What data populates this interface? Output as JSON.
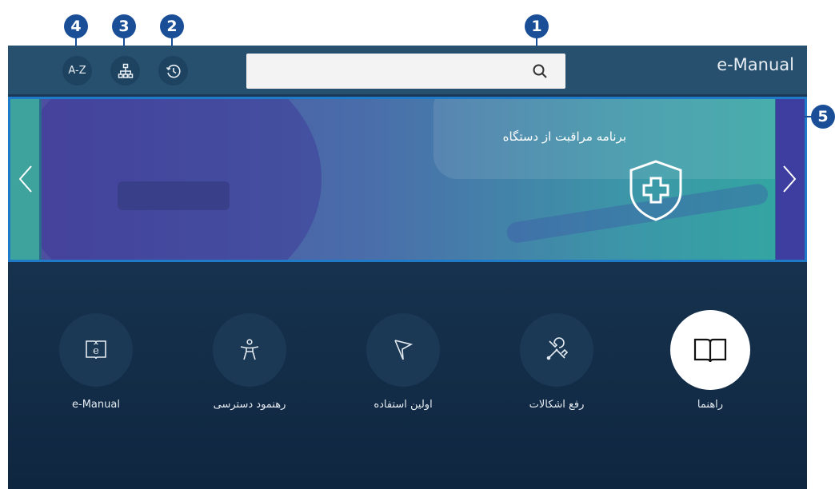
{
  "callouts": {
    "c1": "1",
    "c2": "2",
    "c3": "3",
    "c4": "4",
    "c5": "5"
  },
  "header": {
    "title": "e-Manual",
    "az_label": "A-Z",
    "search": {
      "value": "",
      "placeholder": ""
    }
  },
  "banner": {
    "title": "برنامه مراقبت از دستگاه"
  },
  "items": [
    {
      "label": "e-Manual",
      "icon": "e-manual-book-icon"
    },
    {
      "label": "رهنمود دسترسی",
      "icon": "accessibility-person-icon"
    },
    {
      "label": "اولین استفاده",
      "icon": "flag-icon"
    },
    {
      "label": "رفع اشکالات",
      "icon": "tools-icon"
    },
    {
      "label": "راهنما",
      "icon": "open-book-icon"
    }
  ]
}
